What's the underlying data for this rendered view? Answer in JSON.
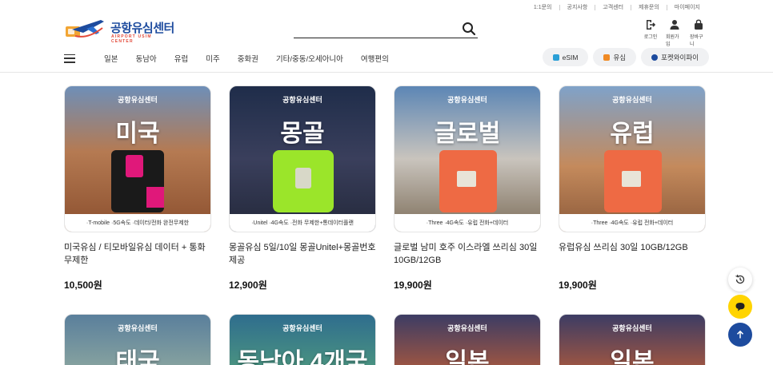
{
  "util_links": [
    "1:1문의",
    "공지사항",
    "고객센터",
    "제휴문의",
    "마이페이지"
  ],
  "logo": {
    "title": "공항유심센터",
    "subtitle": "AIRPORT USIM CENTER"
  },
  "search": {
    "placeholder": ""
  },
  "user_icons": [
    {
      "label": "로그인",
      "icon": "login-icon"
    },
    {
      "label": "회원가입",
      "icon": "user-icon"
    },
    {
      "label": "장바구니",
      "icon": "cart-icon"
    }
  ],
  "nav": [
    "일본",
    "동남아",
    "유럽",
    "미주",
    "중화권",
    "기타/중동/오세아니아",
    "여행편의"
  ],
  "pills": [
    {
      "label": "eSIM",
      "color": "#2a9fd6"
    },
    {
      "label": "유심",
      "color": "#f08a24"
    },
    {
      "label": "포켓와이파이",
      "color": "#1d4b9e"
    }
  ],
  "products": [
    {
      "brand": "공항유심센터",
      "big": "미국",
      "foot": "·T-mobile ·5G속도 ·데이터/전화 완전무제한",
      "name": "미국유심 / 티모바일유심 데이터 + 통화 무제한",
      "price": "10,500원",
      "bg": "linear-gradient(180deg,#6e8fb8 0%,#b57a52 45%,#8b4f2e 100%)"
    },
    {
      "brand": "공항유심센터",
      "big": "몽골",
      "foot": "·Unitel ·4G속도 ·전화 무제한+통데이터플랜",
      "name": "몽골유심 5일/10일 몽골Unitel+몽골번호제공",
      "price": "12,900원",
      "bg": "linear-gradient(180deg,#1f2d4a 0%,#3a3f5c 50%,#23283a 100%)"
    },
    {
      "brand": "공항유심센터",
      "big": "글로벌",
      "foot": "·Three ·4G속도 ·유럽 전화+데이터",
      "name": "글로벌 남미 호주 이스라엘 쓰리심 30일 10GB/12GB",
      "price": "19,900원",
      "bg": "linear-gradient(180deg,#5c86b5 0%,#c9c4bd 50%,#7d6e5a 100%)"
    },
    {
      "brand": "공항유심센터",
      "big": "유럽",
      "foot": "·Three ·4G속도 ·유럽 전화+데이터",
      "name": "유럽유심 쓰리심 30일 10GB/12GB",
      "price": "19,900원",
      "bg": "linear-gradient(180deg,#7fa2c9 0%,#c48a5c 55%,#8c5a3a 100%)"
    }
  ],
  "products_row2": [
    {
      "brand": "공항유심센터",
      "big": "태국",
      "bg": "linear-gradient(180deg,#5a7f9c 0%,#8fa9a0 100%)"
    },
    {
      "brand": "공항유심센터",
      "big": "동남아 4개국",
      "bg": "linear-gradient(180deg,#2f6d8e 0%,#4f9a7e 100%)"
    },
    {
      "brand": "공항유심센터",
      "big": "일본",
      "bg": "linear-gradient(180deg,#3c3c64 0%,#b05a3c 100%)"
    },
    {
      "brand": "공항유심센터",
      "big": "일본",
      "bg": "linear-gradient(180deg,#3c3c64 0%,#b05a3c 100%)"
    }
  ],
  "colors": {
    "brand_blue": "#1d4b9e",
    "chat_yellow": "#ffd400",
    "top_btn": "#1d4b9e"
  }
}
